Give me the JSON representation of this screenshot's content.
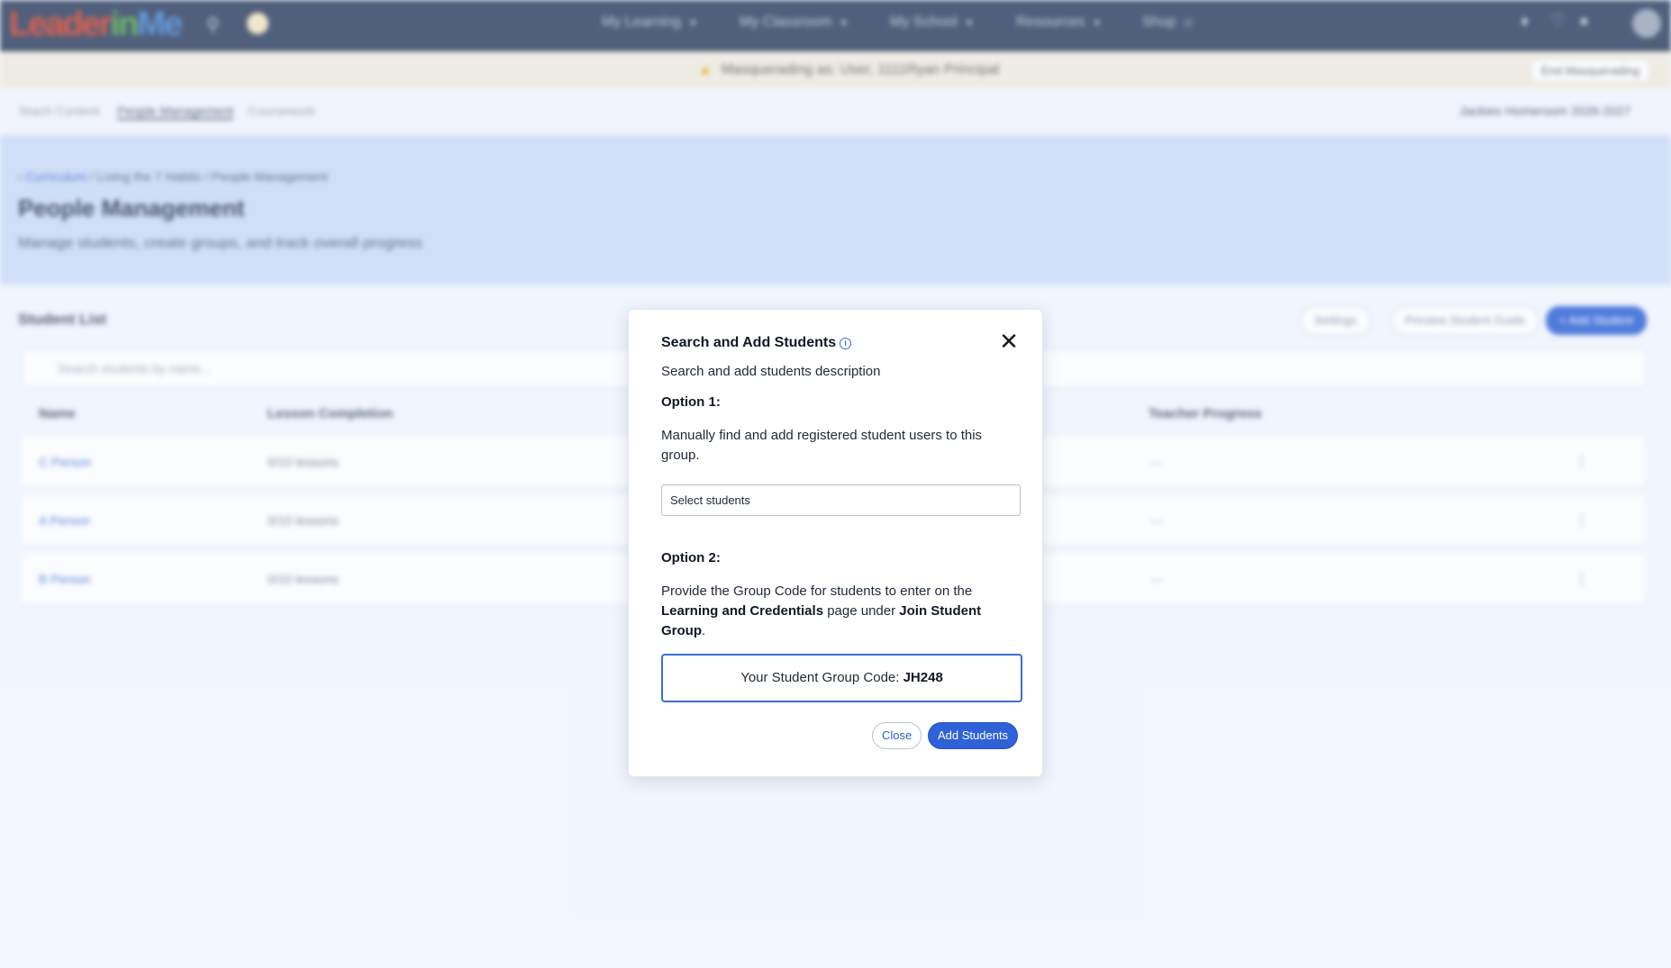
{
  "background": {
    "nav": {
      "logo": [
        "Leader",
        "in",
        "Me"
      ],
      "menus": [
        "My Learning",
        "My Classroom",
        "My School",
        "Resources",
        "Shop"
      ]
    },
    "masquerade": {
      "text": "Masquerading as: User, 1111Ryan Principal",
      "end_label": "End Masquerading"
    },
    "subnav": {
      "tabs": [
        "Teach Content",
        "People Management",
        "Coursework"
      ],
      "right_label": "Jackies Homeroom 2026-2027"
    },
    "hero": {
      "breadcrumb": [
        "Curriculum",
        "Living the 7 Habits",
        "People Management"
      ],
      "title": "People Management",
      "subtitle": "Manage students, create groups, and track overall progress"
    },
    "student_list": {
      "title": "Student List",
      "buttons": [
        "Settings",
        "Preview Student Guide",
        "+ Add Student"
      ],
      "search_placeholder": "Search students by name...",
      "columns": [
        "Name",
        "Lesson Completion",
        "Teacher Progress"
      ],
      "rows": [
        {
          "name": "C Person",
          "lessons": "0/10 lessons",
          "progress": "—"
        },
        {
          "name": "A Person",
          "lessons": "0/10 lessons",
          "progress": "—"
        },
        {
          "name": "B Person",
          "lessons": "0/10 lessons",
          "progress": "—"
        }
      ]
    }
  },
  "modal": {
    "title": "Search and Add Students",
    "description": "Search and add students description",
    "option1": {
      "heading": "Option 1:",
      "text": "Manually find and add registered student users to this group.",
      "select_placeholder": "Select students"
    },
    "option2": {
      "heading": "Option 2:",
      "text_a": "Provide the Group Code for students to enter on the ",
      "bold_a": "Learning and Credentials",
      "text_b": " page under ",
      "bold_b": "Join Student Group",
      "text_c": "."
    },
    "code": {
      "label": "Your Student Group Code: ",
      "value": "JH248"
    },
    "buttons": {
      "close": "Close",
      "add": "Add Students"
    }
  },
  "colors": {
    "primary": "#2f62d6",
    "nav_bg": "#2f4060",
    "hero_bg": "#cbdcf8"
  }
}
